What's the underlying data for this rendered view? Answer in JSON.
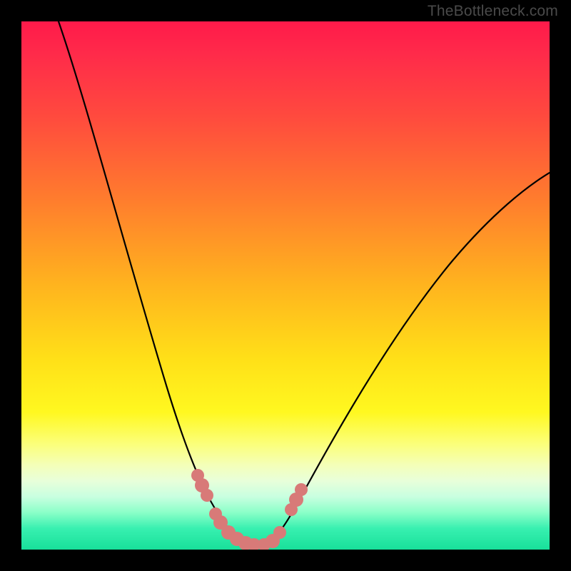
{
  "attribution": "TheBottleneck.com",
  "chart_data": {
    "type": "line",
    "title": "",
    "xlabel": "",
    "ylabel": "",
    "xlim": [
      0,
      100
    ],
    "ylim": [
      0,
      100
    ],
    "series": [
      {
        "name": "left-curve",
        "x": [
          7,
          10,
          14,
          18,
          22,
          26,
          29,
          32,
          34,
          36,
          38,
          40,
          42
        ],
        "y": [
          100,
          88,
          74,
          60,
          46,
          33,
          23,
          15,
          10,
          7,
          5,
          3,
          2
        ]
      },
      {
        "name": "right-curve",
        "x": [
          46,
          48,
          51,
          55,
          60,
          66,
          73,
          81,
          90,
          100
        ],
        "y": [
          2,
          4,
          8,
          14,
          23,
          34,
          45,
          55,
          63,
          70
        ]
      }
    ],
    "annotations": {
      "bead_clusters": [
        {
          "side": "left",
          "approx_x_range": [
            32,
            38
          ],
          "approx_y_range": [
            4,
            14
          ]
        },
        {
          "side": "right",
          "approx_x_range": [
            47,
            51
          ],
          "approx_y_range": [
            3,
            10
          ]
        }
      ],
      "bead_color": "#d87a78"
    },
    "background": {
      "type": "vertical-gradient",
      "stops": [
        {
          "pos": 0.0,
          "color": "#ff1a4a"
        },
        {
          "pos": 0.5,
          "color": "#ffe018"
        },
        {
          "pos": 0.84,
          "color": "#f4ffb8"
        },
        {
          "pos": 1.0,
          "color": "#18e09a"
        }
      ]
    }
  }
}
